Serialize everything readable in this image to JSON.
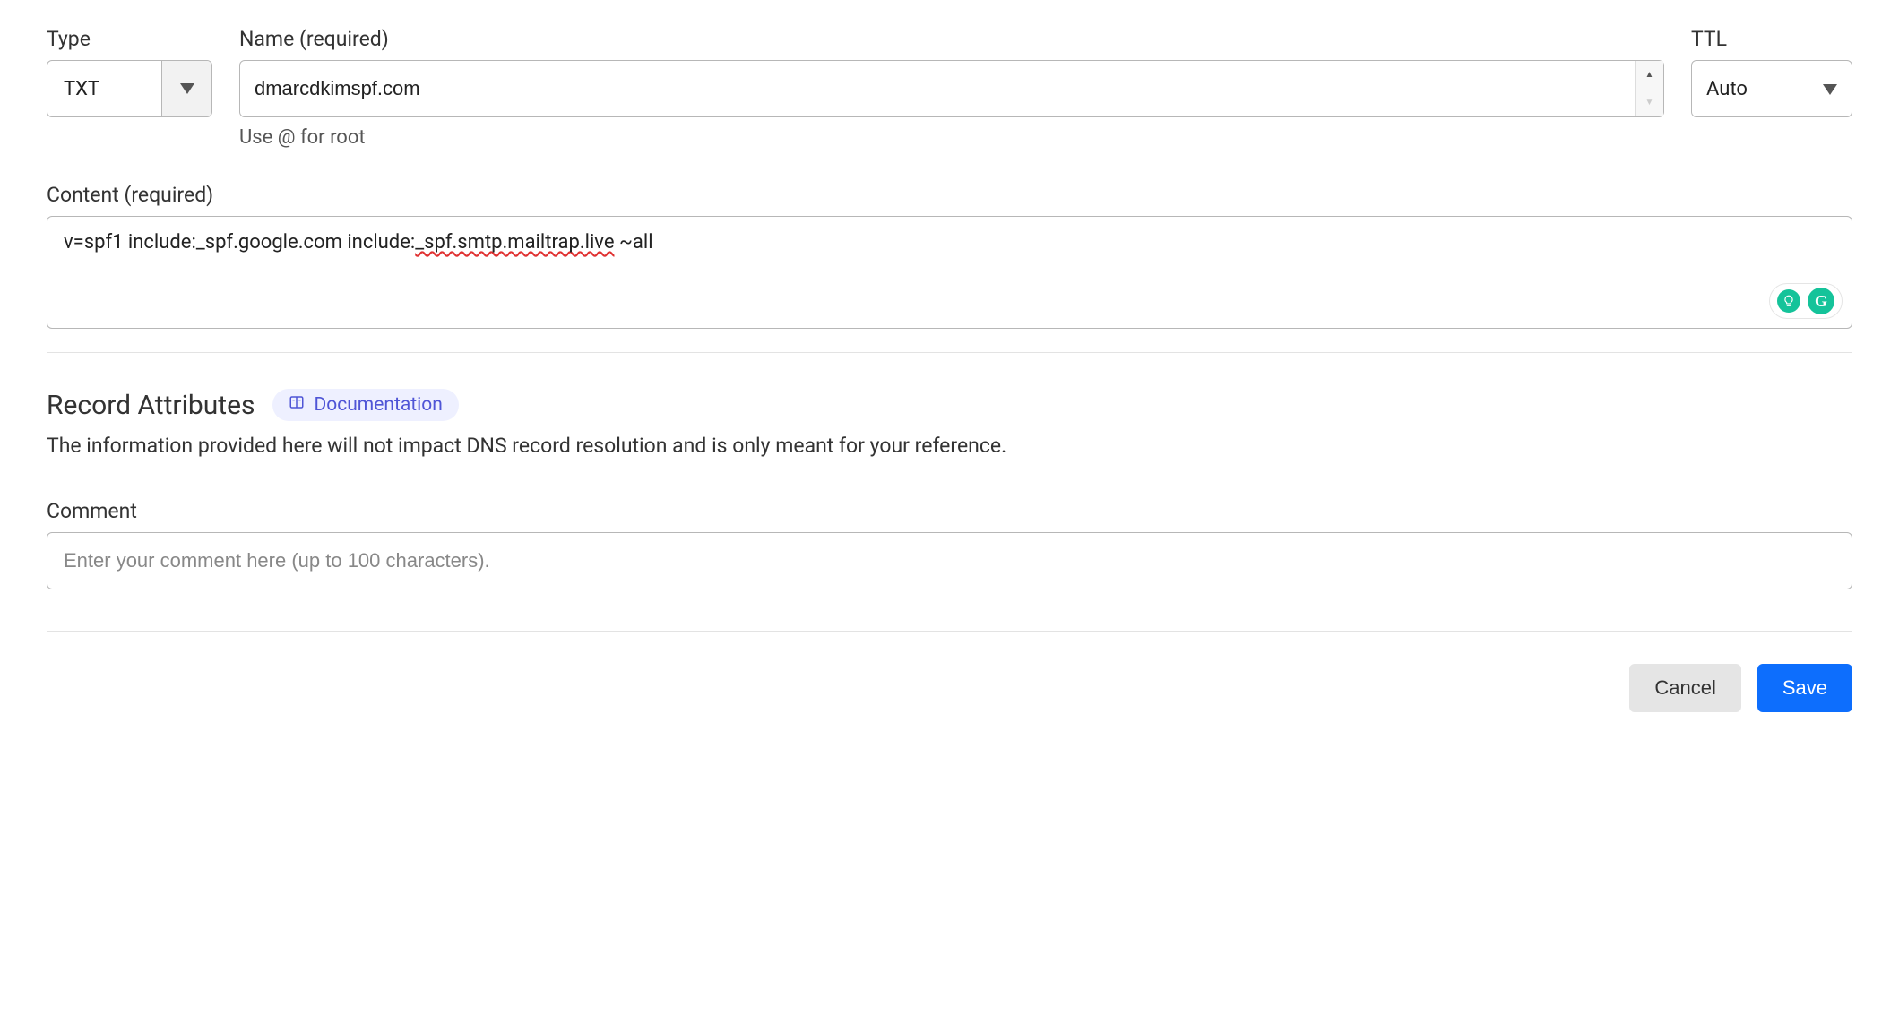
{
  "type": {
    "label": "Type",
    "value": "TXT"
  },
  "name": {
    "label": "Name (required)",
    "value": "dmarcdkimspf.com",
    "helper": "Use @ for root"
  },
  "ttl": {
    "label": "TTL",
    "value": "Auto"
  },
  "content": {
    "label": "Content (required)",
    "prefix": "v=spf1 include:_spf.google.com include:",
    "spellcheck": "_spf.smtp.mailtrap.live",
    "suffix": " ~all"
  },
  "attributes": {
    "title": "Record Attributes",
    "doc_link": "Documentation",
    "description": "The information provided here will not impact DNS record resolution and is only meant for your reference."
  },
  "comment": {
    "label": "Comment",
    "placeholder": "Enter your comment here (up to 100 characters)."
  },
  "actions": {
    "cancel": "Cancel",
    "save": "Save"
  },
  "grammarly": {
    "g": "G"
  }
}
